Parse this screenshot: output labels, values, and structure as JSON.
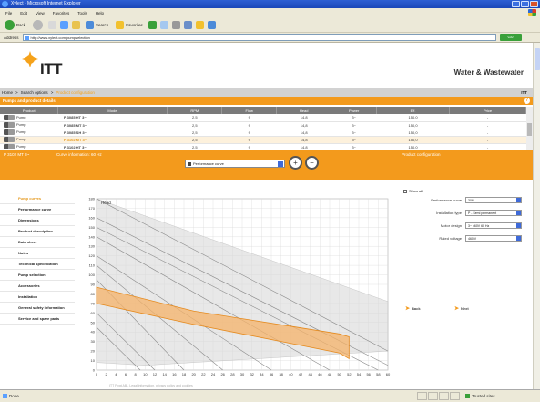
{
  "browser": {
    "title": "Xylect - Microsoft Internet Explorer",
    "menu": [
      "File",
      "Edit",
      "View",
      "Favorites",
      "Tools",
      "Help"
    ],
    "toolbar": {
      "back": "Back",
      "search": "Search",
      "favorites": "Favorites"
    },
    "address_label": "Address",
    "address_value": "http://www.xylect.com/pumpselection",
    "go": "Go",
    "status": "Done",
    "zone": "Trusted sites"
  },
  "header": {
    "logo": "ITT",
    "tagline": "Water & Wastewater",
    "breadcrumb": [
      "Home",
      "Search options",
      "Product configuration"
    ],
    "user": "ITT"
  },
  "results": {
    "title": "Pumps and product details",
    "columns": [
      "Product",
      "Model",
      "RPM",
      "Flow",
      "Head",
      "Power",
      "Eff.",
      "Price"
    ],
    "rows": [
      {
        "product": "Pump",
        "model": "P 3085 HT 3~",
        "c3": "2,5",
        "c4": "9",
        "c5": "14,8",
        "c6": "3~",
        "c7": "150,0",
        "c8": "-",
        "selected": false
      },
      {
        "product": "Pump",
        "model": "P 3085 MT 3~",
        "c3": "2,5",
        "c4": "9",
        "c5": "14,8",
        "c6": "3~",
        "c7": "150,0",
        "c8": "-",
        "selected": false
      },
      {
        "product": "Pump",
        "model": "P 3085 SH 3~",
        "c3": "2,5",
        "c4": "9",
        "c5": "14,8",
        "c6": "3~",
        "c7": "150,0",
        "c8": "-",
        "selected": false
      },
      {
        "product": "Pump",
        "model": "P 3102 MT 3~",
        "c3": "2,5",
        "c4": "9",
        "c5": "14,8",
        "c6": "3~",
        "c7": "150,0",
        "c8": "-",
        "selected": true
      },
      {
        "product": "Pump",
        "model": "P 3102 HT 3~",
        "c3": "2,5",
        "c4": "9",
        "c5": "14,8",
        "c6": "3~",
        "c7": "150,0",
        "c8": "-",
        "selected": false
      },
      {
        "product": "Pump",
        "model": "P 3102 SH 3~",
        "c3": "2,5",
        "c4": "9",
        "c5": "14,8",
        "c6": "3~",
        "c7": "150,0",
        "c8": "-",
        "selected": false
      },
      {
        "product": "Pump",
        "model": "P 3102 LT 3~",
        "c3": "2,5",
        "c4": "9",
        "c5": "14,8",
        "c6": "3~",
        "c7": "150,0",
        "c8": "-",
        "selected": false
      }
    ]
  },
  "selection_bar": {
    "selected": "P 3102 MT 3~",
    "info": "Curve information: 60 Hz",
    "graph_select": "Performance curve",
    "config_title": "Product configuration"
  },
  "side_nav": [
    "Pump curves",
    "Performance curve",
    "Dimensions",
    "Product description",
    "Data sheet",
    "Notes",
    "Technical specification",
    "Pump selection",
    "Accessories",
    "Installation",
    "General safety information",
    "Service and spare parts"
  ],
  "chart_data": {
    "type": "line",
    "title": "Head",
    "x_ticks": [
      "0",
      "2",
      "4",
      "6",
      "8",
      "10",
      "12",
      "14",
      "16",
      "18",
      "20",
      "22",
      "24",
      "26",
      "28",
      "30",
      "32",
      "34",
      "36",
      "38",
      "40",
      "42",
      "44",
      "46",
      "48",
      "50",
      "52",
      "54",
      "56",
      "58",
      "60"
    ],
    "y_ticks": [
      "0",
      "10",
      "20",
      "30",
      "40",
      "50",
      "60",
      "70",
      "80",
      "90",
      "100",
      "110",
      "120",
      "130",
      "140",
      "150",
      "160",
      "170",
      "180"
    ],
    "xlim": [
      0,
      60
    ],
    "ylim": [
      0,
      180
    ],
    "grid": true,
    "background_curves": [
      [
        [
          0,
          180
        ],
        [
          60,
          20
        ]
      ],
      [
        [
          0,
          160
        ],
        [
          60,
          5
        ]
      ],
      [
        [
          0,
          150
        ],
        [
          58,
          0
        ]
      ],
      [
        [
          0,
          140
        ],
        [
          48,
          0
        ]
      ],
      [
        [
          0,
          120
        ],
        [
          36,
          0
        ]
      ],
      [
        [
          0,
          110
        ],
        [
          26,
          0
        ]
      ],
      [
        [
          0,
          95
        ],
        [
          18,
          0
        ]
      ],
      [
        [
          0,
          60
        ],
        [
          12,
          0
        ]
      ],
      [
        [
          0,
          45
        ],
        [
          9,
          0
        ]
      ]
    ],
    "envelope": [
      [
        0,
        180
      ],
      [
        60,
        72
      ],
      [
        60,
        20
      ],
      [
        10,
        5
      ],
      [
        0,
        8
      ]
    ],
    "selected_band": {
      "upper": [
        [
          0,
          87
        ],
        [
          20,
          62
        ],
        [
          40,
          46
        ],
        [
          50,
          38
        ],
        [
          52,
          35
        ]
      ],
      "lower": [
        [
          0,
          70
        ],
        [
          20,
          48
        ],
        [
          40,
          28
        ],
        [
          50,
          18
        ],
        [
          52,
          12
        ]
      ]
    },
    "colors": {
      "band": "#f6b36a",
      "band_stroke": "#e58a1e",
      "envelope": "#d9d9d9",
      "curve": "#8a8a8a",
      "grid": "#dcdcdc"
    }
  },
  "config": {
    "show_all": "Show all",
    "fields": [
      {
        "label": "Performance curve",
        "value": "306"
      },
      {
        "label": "Installation type",
        "value": "P - Semi permanent"
      },
      {
        "label": "Motor design",
        "value": "3~ 460V 60 Hz"
      },
      {
        "label": "Rated voltage",
        "value": "460 V"
      }
    ],
    "back": "Back",
    "next": "Next"
  },
  "footer": "ITT Flygt AB - Legal information, privacy policy and cookies"
}
